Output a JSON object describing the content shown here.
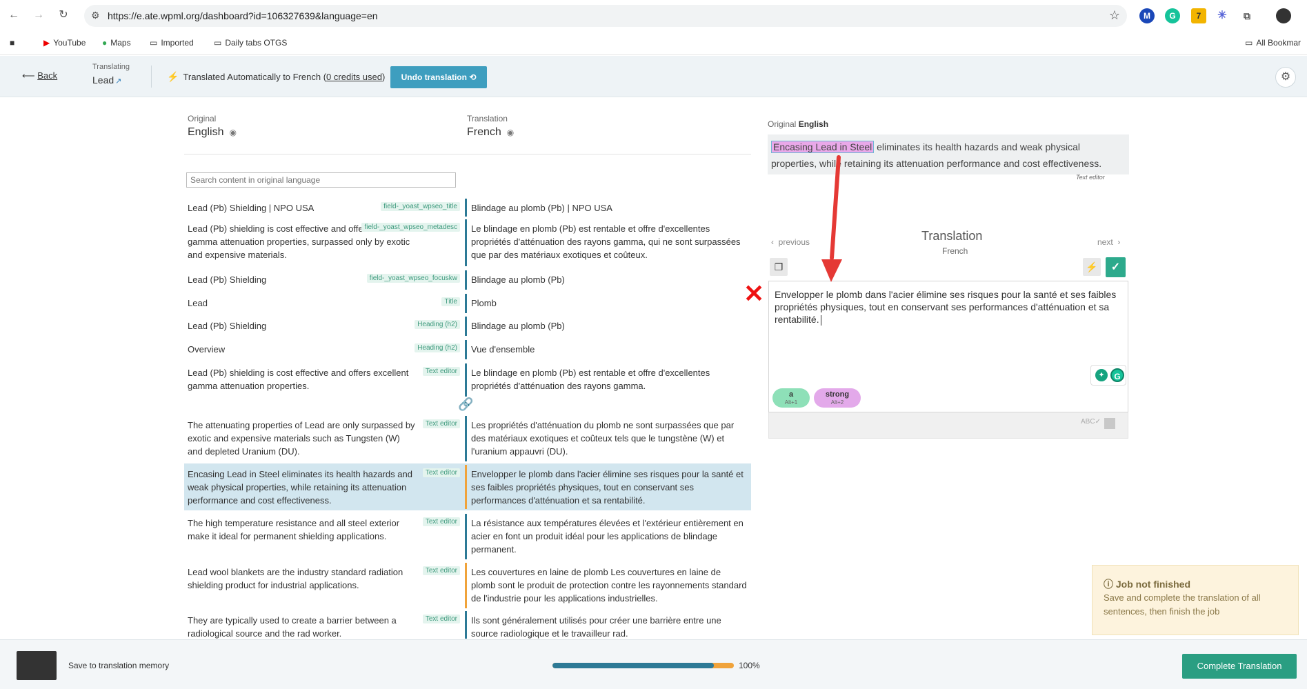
{
  "browser": {
    "url": "https://e.ate.wpml.org/dashboard?id=106327639&language=en",
    "bookmarks": [
      "YouTube",
      "Maps",
      "Imported",
      "Daily tabs OTGS"
    ],
    "all_bookmarks": "All Bookmar",
    "ext_badge": "7"
  },
  "header": {
    "back": "Back",
    "translating_label": "Translating",
    "translating_value": "Lead",
    "auto_prefix": "Translated Automatically to French (",
    "credits": "0 credits used",
    "auto_suffix": ")",
    "undo": "Undo translation"
  },
  "columns": {
    "original_label": "Original",
    "original_lang": "English",
    "translation_label": "Translation",
    "translation_lang": "French",
    "search_placeholder": "Search content in original language"
  },
  "rows": [
    {
      "src": "Lead (Pb) Shielding | NPO USA",
      "tag": "field-_yoast_wpseo_title",
      "tgt": "Blindage au plomb (Pb) | NPO USA"
    },
    {
      "src": "Lead (Pb) shielding is cost effective and offers excellent gamma attenuation properties, surpassed only by exotic and expensive materials.",
      "tag": "field-_yoast_wpseo_metadesc",
      "tgt": "Le blindage en plomb (Pb) est rentable et offre d'excellentes propriétés d'atténuation des rayons gamma, qui ne sont surpassées que par des matériaux exotiques et coûteux."
    },
    {
      "src": "Lead (Pb) Shielding",
      "tag": "field-_yoast_wpseo_focuskw",
      "tgt": "Blindage au plomb (Pb)"
    },
    {
      "src": "Lead",
      "tag": "Title",
      "tgt": "Plomb"
    },
    {
      "src": "Lead (Pb) Shielding",
      "tag": "Heading (h2)",
      "tgt": "Blindage au plomb (Pb)"
    },
    {
      "src": "Overview",
      "tag": "Heading (h2)",
      "tgt": "Vue d'ensemble"
    },
    {
      "src": "Lead (Pb) shielding is cost effective and offers excellent gamma attenuation properties.",
      "tag": "Text editor",
      "tgt": "Le blindage en plomb (Pb) est rentable et offre d'excellentes propriétés d'atténuation des rayons gamma."
    },
    {
      "src": "The attenuating properties of Lead are only surpassed by exotic and expensive materials such as Tungsten (W) and depleted Uranium (DU).",
      "tag": "Text editor",
      "tgt": "Les propriétés d'atténuation du plomb ne sont surpassées que par des matériaux exotiques et coûteux tels que le tungstène (W) et l'uranium appauvri (DU)."
    },
    {
      "src": "Encasing Lead in Steel eliminates its health hazards and weak physical properties, while retaining its attenuation performance and cost effectiveness.",
      "tag": "Text editor",
      "tgt": "Envelopper le plomb dans l'acier élimine ses risques pour la santé et ses faibles propriétés physiques, tout en conservant ses performances d'atténuation et sa rentabilité."
    },
    {
      "src": "The high temperature resistance and all steel exterior make it ideal for permanent shielding applications.",
      "tag": "Text editor",
      "tgt": "La résistance aux températures élevées et l'extérieur entièrement en acier en font un produit idéal pour les applications de blindage permanent."
    },
    {
      "src": "Lead wool blankets are the industry standard radiation shielding product for industrial applications.",
      "tag": "Text editor",
      "tgt": "Les couvertures en laine de plomb Les couvertures en laine de plomb sont le produit de protection contre les rayonnements standard de l'industrie pour les applications industrielles."
    },
    {
      "src": "They are typically used to create a barrier between a radiological source and the rad worker.",
      "tag": "Text editor",
      "tgt": "Ils sont généralement utilisés pour créer une barrière entre une source radiologique et le travailleur rad."
    }
  ],
  "panel": {
    "orig_label": "Original",
    "orig_lang": "English",
    "orig_highlight": "Encasing Lead in Steel",
    "orig_rest": " eliminates its health hazards and weak physical properties, while retaining its attenuation performance and cost effectiveness.",
    "text_editor_note": "Text editor",
    "translation_title": "Translation",
    "translation_lang": "French",
    "previous": "previous",
    "next": "next",
    "editor_text": "Envelopper le plomb dans l'acier élimine ses risques pour la santé et ses faibles propriétés physiques, tout en conservant ses performances d'atténuation et sa rentabilité.",
    "chip_a": "a",
    "chip_a_key": "Alt+1",
    "chip_strong": "strong",
    "chip_strong_key": "Alt+2",
    "abc": "ABC"
  },
  "notice": {
    "title": "Job not finished",
    "text": "Save and complete the translation of all sentences, then finish the job"
  },
  "footer": {
    "save_memory": "Save to translation memory",
    "progress_pct": "100%",
    "progress_fraction": 0.89,
    "complete": "Complete Translation"
  },
  "colors": {
    "accent": "#3e9ebf",
    "complete": "#2a9e82",
    "bar_done": "#2d7a96",
    "bar_pending": "#f0a33b"
  }
}
